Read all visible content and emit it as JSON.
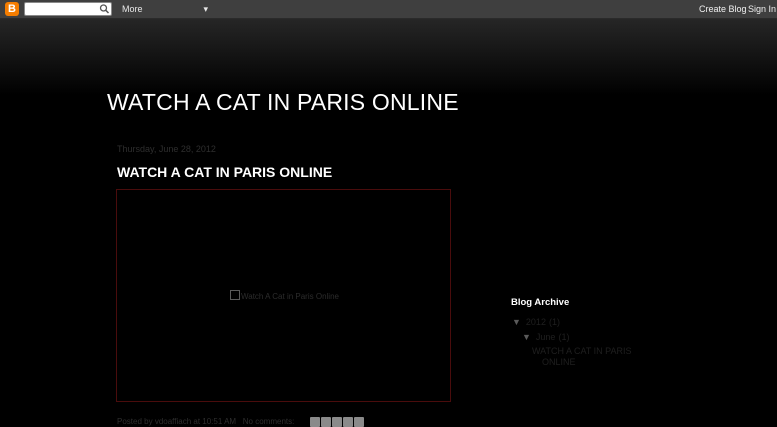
{
  "navbar": {
    "logo_letter": "B",
    "search_placeholder": "",
    "more_label": "More",
    "create_blog_label": "Create Blog",
    "sign_in_label": "Sign In"
  },
  "blog": {
    "title": "WATCH A CAT IN PARIS ONLINE"
  },
  "post": {
    "date": "Thursday, June 28, 2012",
    "title": "WATCH A CAT IN PARIS ONLINE",
    "image_alt": "Watch A Cat in Paris Online",
    "footer_posted_by": "Posted by",
    "footer_author": "vdoaffiach",
    "footer_at": "at",
    "footer_time": "10:51 AM",
    "footer_comments": "No comments:"
  },
  "sidebar": {
    "archive_title": "Blog Archive",
    "year": {
      "toggle": "▼",
      "label": "2012",
      "count": "(1)"
    },
    "month": {
      "toggle": "▼",
      "label": "June",
      "count": "(1)"
    },
    "post_link": "WATCH A CAT IN PARIS ONLINE"
  },
  "icons": {
    "logo": "blogger-logo-icon",
    "search": "search-icon",
    "chevron": "chevron-down-icon"
  },
  "colors": {
    "navbar_bg": "#3f3f3f",
    "logo_orange": "#f57d00",
    "page_bg": "#000000",
    "frame_border": "#4a0c0c"
  }
}
